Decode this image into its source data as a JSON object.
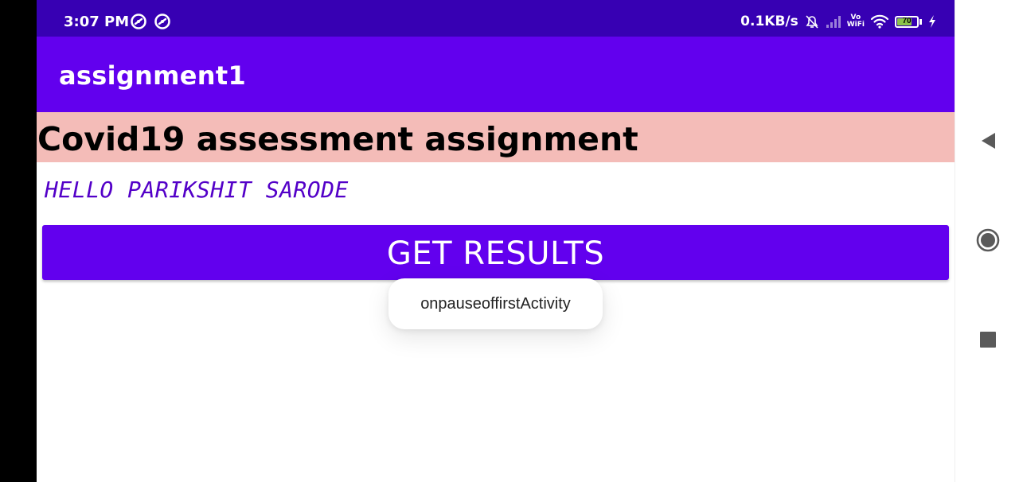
{
  "status_bar": {
    "time": "3:07 PM",
    "left_icons": [
      "sync-circle-icon",
      "sync-circle-icon"
    ],
    "net_speed": "0.1KB/s",
    "right_icons": [
      "alarm-off-icon",
      "signal-icon",
      "vowifi-icon",
      "wifi-icon",
      "battery-icon",
      "charging-bolt-icon"
    ],
    "vowifi_top": "Vo",
    "vowifi_bottom": "WiFi",
    "battery_level": "70",
    "battery_fraction": 0.7,
    "background_color": "#3700b3"
  },
  "app_bar": {
    "title": "assignment1",
    "background_color": "#6200ee"
  },
  "main": {
    "heading": "Covid19 assessment assignment",
    "heading_background": "#f4bcb8",
    "greeting": "HELLO PARIKSHIT SARODE",
    "greeting_color": "#5300c8",
    "button_label": "GET RESULTS",
    "button_color": "#6200ee"
  },
  "toast": {
    "message": "onpauseoffirstActivity"
  },
  "nav_bar": {
    "buttons": [
      "back-triangle-icon",
      "home-circle-icon",
      "recents-square-icon"
    ]
  }
}
